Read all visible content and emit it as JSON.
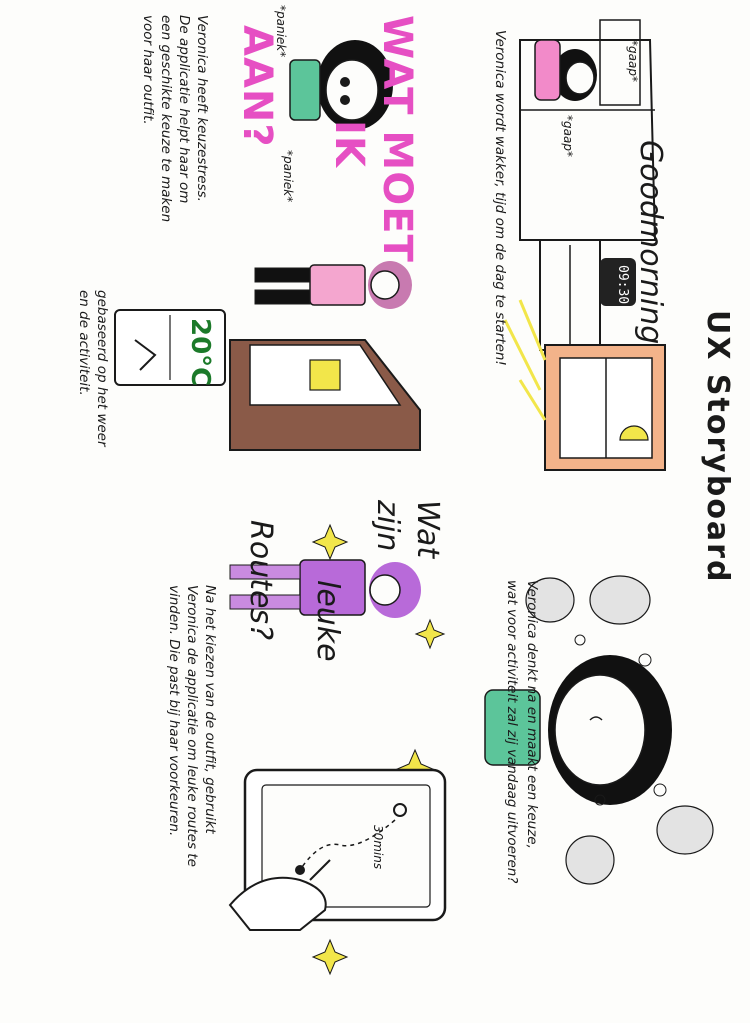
{
  "title": "UX Storyboard",
  "panels": [
    {
      "id": "wake",
      "exclamations": [
        "*gaap*",
        "*gaap*"
      ],
      "greeting": "Goodmorning",
      "clock": "09:30",
      "caption": "Veronica wordt wakker, tijd om de dag te starten!"
    },
    {
      "id": "panic",
      "speech_line1": "WAT MOET",
      "speech_line2": "IK",
      "speech_line3": "AAN?",
      "exclamations": [
        "*paniek*",
        "*paniek*"
      ],
      "caption_lines": [
        "Veronica heeft keuzestress.",
        "De applicatie helpt haar om",
        "een geschikte keuze te maken",
        "voor haar outfit."
      ]
    },
    {
      "id": "outfit",
      "price": "20°C",
      "caption_lines": [
        "gebaseerd op het weer",
        "en de activiteit."
      ]
    },
    {
      "id": "think",
      "caption_lines": [
        "Veronica denkt na en maakt een keuze,",
        "wat voor activiteit zal zij vandaag uitvoeren?"
      ]
    },
    {
      "id": "routes",
      "speech_line1": "Wat",
      "speech_line2": "zijn",
      "speech_line3": "leuke",
      "speech_line4": "Routes?",
      "caption_lines": [
        "Na het kiezen van de outfit, gebruikt",
        "Veronica de applicatie om leuke routes te",
        "vinden. Die past bij haar voorkeuren."
      ]
    },
    {
      "id": "tablet",
      "duration": "30mins"
    }
  ],
  "colors": {
    "pink": "#e64fc3",
    "purple": "#b86ad9",
    "green": "#5cc59a",
    "yellow": "#f2e64a",
    "brown": "#8a5a48",
    "peach": "#f3b38a",
    "ink": "#1a1a1a"
  }
}
